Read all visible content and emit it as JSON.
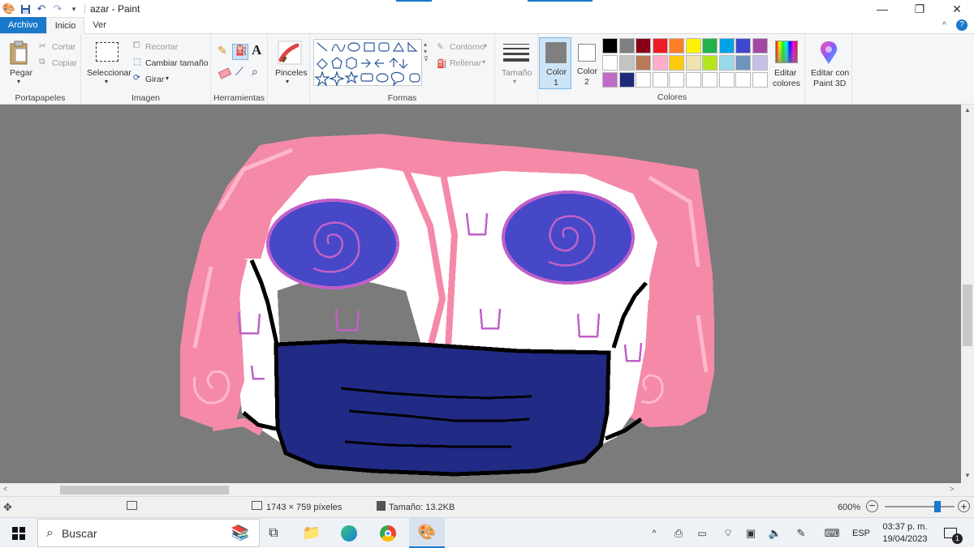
{
  "window": {
    "title": "azar - Paint",
    "minimize": "—",
    "restore": "❐",
    "close": "✕"
  },
  "quick_access": [
    "paint-app-icon",
    "save-icon",
    "undo-icon",
    "redo-icon",
    "customize-icon"
  ],
  "tabs": {
    "file": "Archivo",
    "home": "Inicio",
    "view": "Ver"
  },
  "ribbon": {
    "clipboard": {
      "label": "Portapapeles",
      "paste": "Pegar",
      "cut": "Cortar",
      "copy": "Copiar"
    },
    "image": {
      "label": "Imagen",
      "select": "Seleccionar",
      "crop": "Recortar",
      "resize": "Cambiar tamaño",
      "rotate": "Girar"
    },
    "tools": {
      "label": "Herramientas"
    },
    "brushes": {
      "label": "Pinceles"
    },
    "shapes": {
      "label": "Formas",
      "outline": "Contorno",
      "fill": "Rellenar"
    },
    "size": {
      "label": "Tamaño"
    },
    "color1": {
      "label": "Color",
      "num": "1",
      "value": "#7f7f7f"
    },
    "color2": {
      "label": "Color",
      "num": "2",
      "value": "#ffffff"
    },
    "colors": {
      "label": "Colores",
      "edit1": "Editar",
      "edit2": "colores"
    },
    "paint3d": {
      "line1": "Editar con",
      "line2": "Paint 3D"
    }
  },
  "palette": [
    "#000000",
    "#7f7f7f",
    "#880015",
    "#ed1c24",
    "#ff7f27",
    "#fff200",
    "#22b14c",
    "#00a2e8",
    "#3f48cc",
    "#a349a4",
    "#ffffff",
    "#c3c3c3",
    "#b97a57",
    "#ffaec9",
    "#ffc90e",
    "#efe4b0",
    "#b5e61d",
    "#99d9ea",
    "#7092be",
    "#c8bfe7",
    "#c06bc8",
    "#1f2a7a",
    "#ffffff",
    "#ffffff",
    "#ffffff",
    "#ffffff",
    "#ffffff",
    "#ffffff",
    "#ffffff",
    "#ffffff"
  ],
  "status": {
    "dimensions": "1743 × 759 píxeles",
    "filesize": "Tamaño: 13.2KB",
    "zoom": "600%"
  },
  "taskbar": {
    "search": "Buscar",
    "language": "ESP",
    "time": "03:37 p. m.",
    "date": "19/04/2023",
    "notifications": "1"
  },
  "colors": {
    "accent": "#1979ca",
    "canvas_bg": "#7b7b7b",
    "hair": "#f48aa8",
    "hair_light": "#ffb7c9",
    "eye": "#4648c8",
    "eye_swirl": "#c060c8",
    "mask": "#212a84"
  }
}
